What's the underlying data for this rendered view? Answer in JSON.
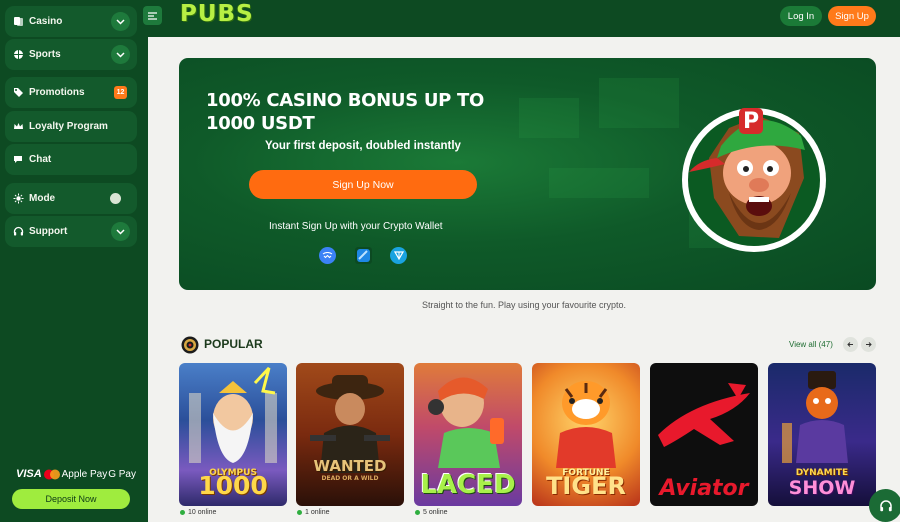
{
  "sidebar": {
    "items": [
      {
        "label": "Casino",
        "icon": "cards-icon"
      },
      {
        "label": "Sports",
        "icon": "ball-icon"
      },
      {
        "label": "Promotions",
        "icon": "tag-icon",
        "badge": "12"
      },
      {
        "label": "Loyalty Program",
        "icon": "crown-icon"
      },
      {
        "label": "Chat",
        "icon": "chat-icon"
      },
      {
        "label": "Mode",
        "icon": "sun-icon"
      },
      {
        "label": "Support",
        "icon": "headset-icon"
      }
    ],
    "payments": [
      "VISA",
      "Apple Pay",
      "G Pay"
    ],
    "deposit_label": "Deposit Now"
  },
  "header": {
    "logo": "PUBS",
    "login_label": "Log In",
    "signup_label": "Sign Up"
  },
  "banner": {
    "title": "100% CASINO BONUS UP TO 1000 USDT",
    "subtitle": "Your first deposit, doubled instantly",
    "cta_label": "Sign Up Now",
    "wallet_text": "Instant Sign Up with your Crypto Wallet",
    "mascot_letter": "P"
  },
  "tagline": "Straight to the fun. Play using your favourite crypto.",
  "popular": {
    "title": "POPULAR",
    "view_all": "View all (47)",
    "games": [
      {
        "name": "1000",
        "sub": "OLYMPUS",
        "online": "10 online"
      },
      {
        "name": "WANTED",
        "sub": "DEAD OR A WILD",
        "online": "1 online"
      },
      {
        "name": "LACED",
        "sub": "",
        "online": "5 online"
      },
      {
        "name": "TIGER",
        "sub": "FORTUNE",
        "online": ""
      },
      {
        "name": "Aviator",
        "sub": "",
        "online": ""
      },
      {
        "name": "SHOW",
        "sub": "DYNAMITE",
        "online": ""
      }
    ]
  },
  "colors": {
    "brand_green": "#0d4a22",
    "accent_orange": "#ff7a1a",
    "lime": "#9fec3e"
  }
}
